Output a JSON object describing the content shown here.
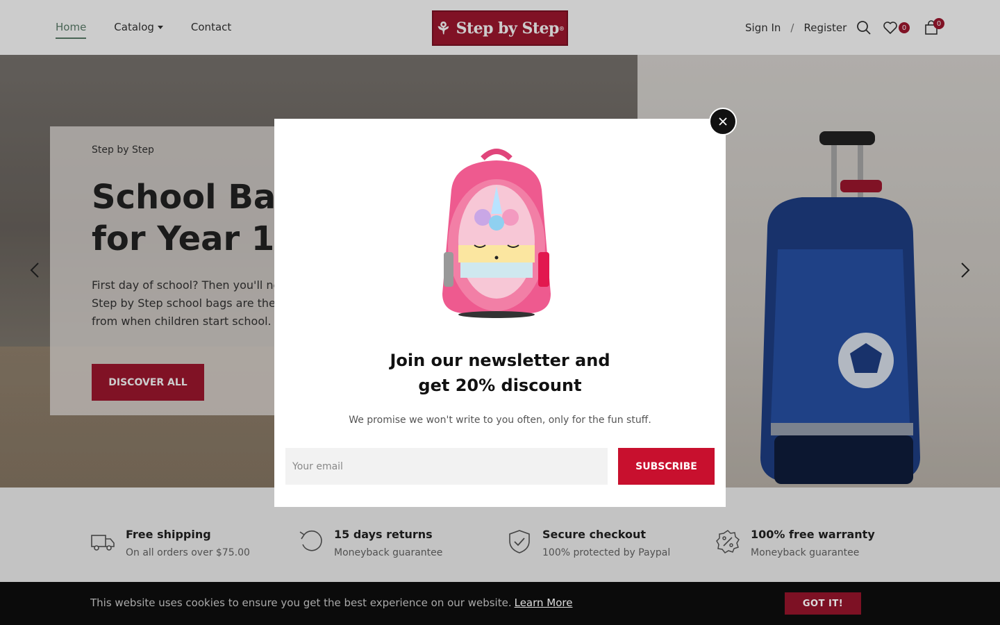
{
  "header": {
    "nav": [
      {
        "label": "Home"
      },
      {
        "label": "Catalog"
      },
      {
        "label": "Contact"
      }
    ],
    "logo_text": "Step by Step",
    "logo_mark": "®",
    "sign_in": "Sign In",
    "separator": "/",
    "register": "Register",
    "wishlist_count": "0",
    "cart_count": "0"
  },
  "hero": {
    "eyebrow": "Step by Step",
    "title": "School Bag\nfor Year 1 to",
    "text": "First day of school? Then you'll ne\nStep by Step school bags are the\nfrom when children start school.",
    "button": "DISCOVER ALL"
  },
  "features": [
    {
      "title": "Free shipping",
      "sub": "On all orders over $75.00",
      "icon": "truck-icon"
    },
    {
      "title": "15 days returns",
      "sub": "Moneyback guarantee",
      "icon": "return-icon"
    },
    {
      "title": "Secure checkout",
      "sub": "100% protected by Paypal",
      "icon": "shield-icon"
    },
    {
      "title": "100% free warranty",
      "sub": "Moneyback guarantee",
      "icon": "discount-icon"
    }
  ],
  "modal": {
    "title": "Join our newsletter and\nget 20% discount",
    "text": "We promise we won't write to you often, only for the fun stuff.",
    "email_placeholder": "Your email",
    "subscribe": "SUBSCRIBE"
  },
  "cookie": {
    "text": "This website uses cookies to ensure you get the best experience on our website.",
    "learn_more": "Learn More",
    "button": "GOT IT!"
  },
  "colors": {
    "brand": "#a0172f",
    "accent_green": "#5a7d6a",
    "cta": "#c8102e"
  }
}
